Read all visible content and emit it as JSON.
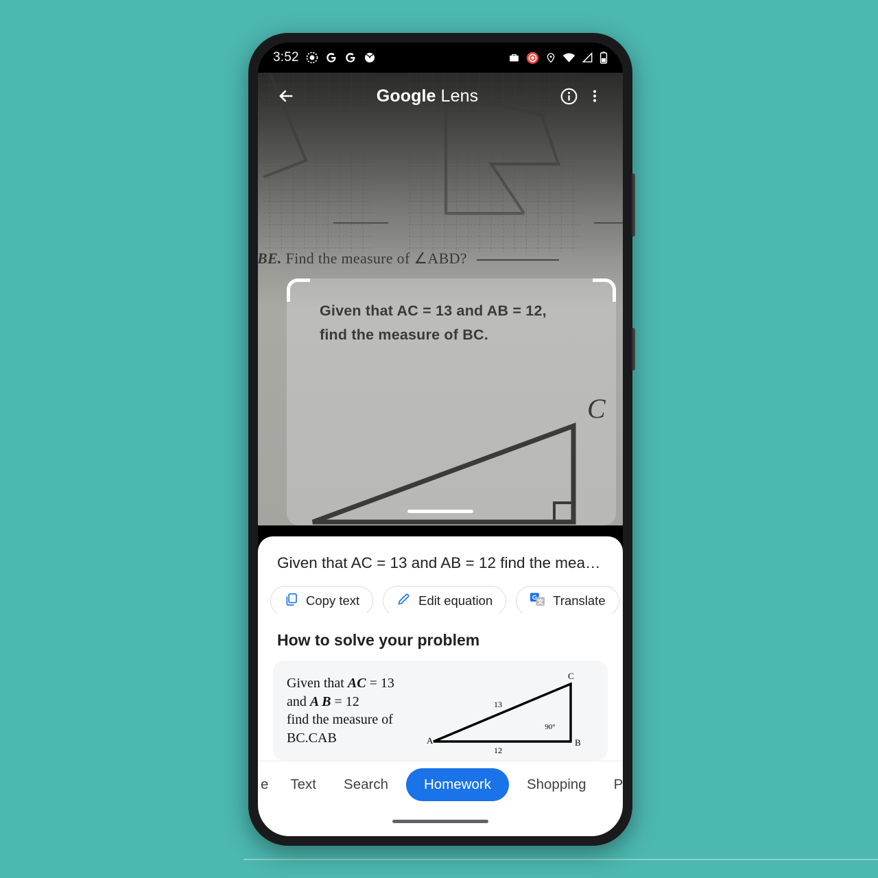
{
  "theme": {
    "backdrop": "#4cb8b0",
    "accent_blue": "#1a73e8",
    "sheet_bg": "#ffffff",
    "card_bg": "#f5f6f7"
  },
  "status_bar": {
    "time": "3:52",
    "left_icons": [
      "record-dot-icon",
      "google-g-icon",
      "google-g-icon",
      "ball-icon"
    ],
    "right_icons": [
      "briefcase-icon",
      "recording-badge-icon",
      "location-pin-icon",
      "wifi-icon",
      "cell-signal-icon",
      "battery-icon"
    ]
  },
  "app_bar": {
    "back_icon": "back-arrow-icon",
    "title_bold": "Google",
    "title_light": " Lens",
    "info_icon": "info-icon",
    "overflow_icon": "more-vert-icon"
  },
  "viewfinder": {
    "worksheet_question_prefix": "ABE.",
    "worksheet_question": "Find the measure of ∠ABD?",
    "selected_text_line1": "Given that AC = 13 and AB = 12,",
    "selected_text_line2": "find the measure of BC.",
    "vertex_c_label": "C",
    "drag_handle": "drag-handle"
  },
  "sheet": {
    "ocr_text": "Given that AC = 13 and AB = 12 find the mea…",
    "chips": [
      {
        "label": "Copy text",
        "icon": "copy-icon"
      },
      {
        "label": "Edit equation",
        "icon": "pencil-icon"
      },
      {
        "label": "Translate",
        "icon": "google-translate-icon"
      }
    ],
    "section_title": "How to solve your problem",
    "answer_card": {
      "line1_pre": "Given that ",
      "line1_var": "AC",
      "line1_post": " = 13",
      "line2_pre": "and ",
      "line2_var": "A B",
      "line2_post": " = 12",
      "line3": "find the measure of",
      "line4": "BC.CAB"
    },
    "tabs": [
      {
        "label": "e",
        "active": false,
        "clipped": true
      },
      {
        "label": "Text",
        "active": false
      },
      {
        "label": "Search",
        "active": false
      },
      {
        "label": "Homework",
        "active": true
      },
      {
        "label": "Shopping",
        "active": false
      },
      {
        "label": "Places",
        "active": false
      }
    ]
  },
  "chart_data": {
    "type": "diagram",
    "title": "Right triangle ABC",
    "vertices": [
      {
        "name": "A",
        "x": 0,
        "y": 0
      },
      {
        "name": "B",
        "x": 12,
        "y": 0
      },
      {
        "name": "C",
        "x": 12,
        "y": 5
      }
    ],
    "edge_labels": [
      {
        "edge": "AB",
        "label": "12"
      },
      {
        "edge": "AC",
        "label": "13"
      }
    ],
    "angle_labels": [
      {
        "at": "B",
        "label": "90°"
      }
    ]
  }
}
